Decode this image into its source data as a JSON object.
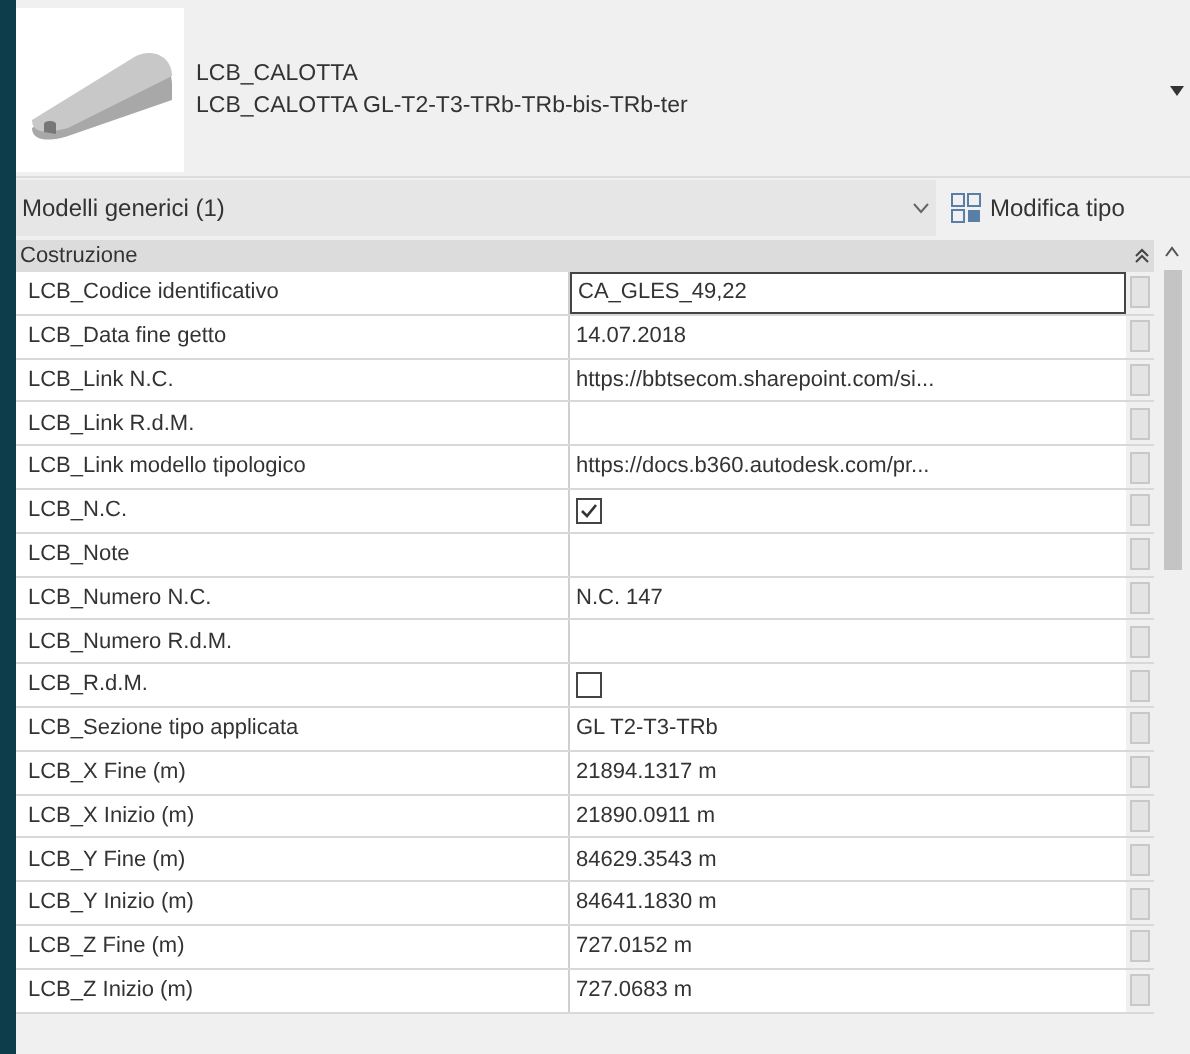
{
  "type_selector": {
    "family": "LCB_CALOTTA",
    "type": "LCB_CALOTTA GL-T2-T3-TRb-TRb-bis-TRb-ter"
  },
  "filter": {
    "value": "Modelli generici (1)"
  },
  "edit_type_button": {
    "label": "Modifica tipo"
  },
  "group": {
    "title": "Costruzione",
    "expanded": true
  },
  "rows": [
    {
      "kind": "text",
      "name": "LCB_Codice identificativo",
      "value": "CA_GLES_49,22",
      "selected": true
    },
    {
      "kind": "text",
      "name": "LCB_Data fine getto",
      "value": "14.07.2018",
      "selected": false
    },
    {
      "kind": "text",
      "name": "LCB_Link N.C.",
      "value": "https://bbtsecom.sharepoint.com/si...",
      "selected": false
    },
    {
      "kind": "text",
      "name": "LCB_Link R.d.M.",
      "selected": false
    },
    {
      "kind": "text",
      "name": "LCB_Link modello tipologico",
      "value": "https://docs.b360.autodesk.com/pr...",
      "selected": false
    },
    {
      "kind": "checkbox",
      "name": "LCB_N.C.",
      "checked": true,
      "selected": false
    },
    {
      "kind": "text",
      "name": "LCB_Note",
      "selected": false
    },
    {
      "kind": "text",
      "name": "LCB_Numero N.C.",
      "value": "N.C. 147",
      "selected": false
    },
    {
      "kind": "text",
      "name": "LCB_Numero R.d.M.",
      "selected": false
    },
    {
      "kind": "checkbox",
      "name": "LCB_R.d.M.",
      "checked": false,
      "selected": false
    },
    {
      "kind": "text",
      "name": "LCB_Sezione tipo applicata",
      "value": "GL T2-T3-TRb",
      "selected": false
    },
    {
      "kind": "text",
      "name": "LCB_X Fine (m)",
      "value": "21894.1317 m",
      "selected": false
    },
    {
      "kind": "text",
      "name": "LCB_X Inizio (m)",
      "value": "21890.0911 m",
      "selected": false
    },
    {
      "kind": "text",
      "name": "LCB_Y Fine (m)",
      "value": "84629.3543 m",
      "selected": false
    },
    {
      "kind": "text",
      "name": "LCB_Y Inizio (m)",
      "value": "84641.1830 m",
      "selected": false
    },
    {
      "kind": "text",
      "name": "LCB_Z Fine (m)",
      "value": "727.0152 m",
      "selected": false
    },
    {
      "kind": "text",
      "name": "LCB_Z Inizio (m)",
      "value": "727.0683 m",
      "selected": false
    }
  ]
}
